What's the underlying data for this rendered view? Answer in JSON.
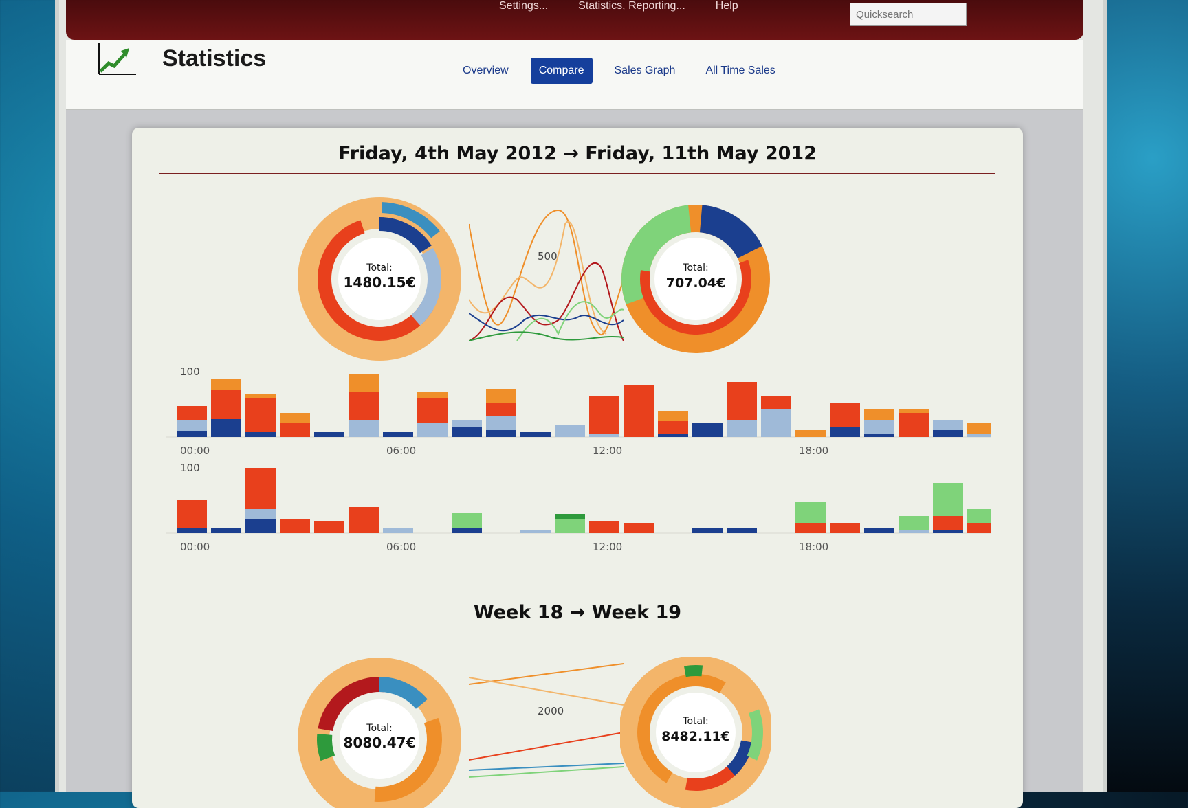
{
  "topbar": {
    "menu": [
      "Settings...",
      "Statistics, Reporting...",
      "Help"
    ],
    "search_placeholder": "Quicksearch"
  },
  "header": {
    "title": "Statistics",
    "logo_icon": "line-chart-icon",
    "tabs": [
      {
        "label": "Overview"
      },
      {
        "label": "Compare",
        "active": true
      },
      {
        "label": "Sales Graph"
      },
      {
        "label": "All Time Sales"
      }
    ]
  },
  "section1": {
    "title": "Friday, 4th May 2012 → Friday, 11th May 2012",
    "donut_left": {
      "label": "Total:",
      "value": "1480.15€"
    },
    "donut_right": {
      "label": "Total:",
      "value": "707.04€"
    },
    "line_tick": "500",
    "bar_tick": "100",
    "time_labels": [
      "00:00",
      "06:00",
      "12:00",
      "18:00"
    ]
  },
  "section2": {
    "title": "Week 18 → Week 19",
    "donut_left": {
      "label": "Total:",
      "value": "8080.47€"
    },
    "donut_right": {
      "label": "Total:",
      "value": "8482.11€"
    },
    "line_tick": "2000"
  },
  "colors": {
    "dark_blue": "#1b3f8f",
    "light_blue": "#9fbad8",
    "red": "#e8401c",
    "orange": "#ef8f2a",
    "light_orange": "#f3b56a",
    "green": "#2e9a3c",
    "light_green": "#7fd37a",
    "dark_red": "#b3191d"
  },
  "chart_data": [
    {
      "type": "bar",
      "title": "",
      "series_order": [
        "dark_blue",
        "light_blue",
        "red",
        "orange"
      ],
      "values": [
        [
          8,
          17,
          20,
          0
        ],
        [
          26,
          0,
          43,
          15
        ],
        [
          7,
          0,
          50,
          5
        ],
        [
          0,
          0,
          20,
          15
        ],
        [
          7,
          0,
          0,
          0
        ],
        [
          0,
          25,
          40,
          27
        ],
        [
          7,
          0,
          0,
          0
        ],
        [
          0,
          20,
          37,
          8
        ],
        [
          15,
          10,
          0,
          0
        ],
        [
          10,
          20,
          20,
          20
        ],
        [
          7,
          0,
          0,
          0
        ],
        [
          0,
          17,
          0,
          0
        ],
        [
          0,
          5,
          55,
          0
        ],
        [
          0,
          0,
          75,
          0
        ],
        [
          5,
          0,
          18,
          15
        ],
        [
          20,
          0,
          0,
          0
        ],
        [
          0,
          25,
          55,
          0
        ],
        [
          0,
          40,
          20,
          0
        ],
        [
          0,
          0,
          0,
          10
        ],
        [
          15,
          0,
          35,
          0
        ],
        [
          5,
          20,
          0,
          15
        ],
        [
          0,
          0,
          35,
          5
        ],
        [
          10,
          15,
          0,
          0
        ],
        [
          0,
          5,
          0,
          15
        ]
      ]
    },
    {
      "type": "bar",
      "title": "",
      "series_order": [
        "dark_blue",
        "light_blue",
        "red",
        "light_green",
        "green"
      ],
      "values": [
        [
          8,
          0,
          40,
          0,
          0
        ],
        [
          8,
          0,
          0,
          0,
          0
        ],
        [
          20,
          15,
          60,
          0,
          0
        ],
        [
          0,
          0,
          20,
          0,
          0
        ],
        [
          0,
          0,
          18,
          0,
          0
        ],
        [
          0,
          0,
          38,
          0,
          0
        ],
        [
          0,
          8,
          0,
          0,
          0
        ],
        [
          0,
          0,
          0,
          0,
          0
        ],
        [
          8,
          0,
          0,
          22,
          0
        ],
        [
          0,
          0,
          0,
          0,
          0
        ],
        [
          0,
          5,
          0,
          0,
          0
        ],
        [
          0,
          0,
          0,
          20,
          8
        ],
        [
          0,
          0,
          18,
          0,
          0
        ],
        [
          0,
          0,
          15,
          0,
          0
        ],
        [
          0,
          0,
          0,
          0,
          0
        ],
        [
          7,
          0,
          0,
          0,
          0
        ],
        [
          7,
          0,
          0,
          0,
          0
        ],
        [
          0,
          0,
          0,
          0,
          0
        ],
        [
          0,
          0,
          15,
          30,
          0
        ],
        [
          0,
          0,
          15,
          0,
          0
        ],
        [
          7,
          0,
          0,
          0,
          0
        ],
        [
          0,
          5,
          0,
          20,
          0
        ],
        [
          5,
          0,
          20,
          48,
          0
        ],
        [
          0,
          0,
          15,
          20,
          0
        ]
      ]
    }
  ]
}
